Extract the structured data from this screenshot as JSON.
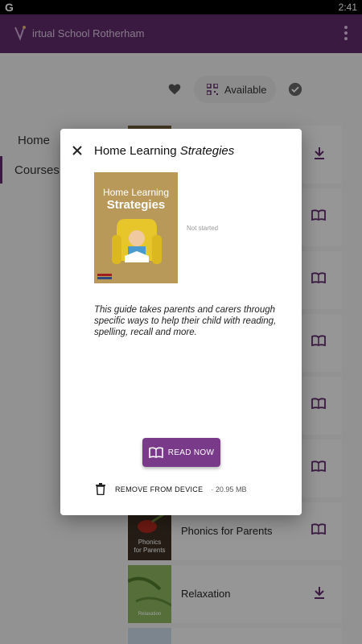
{
  "status": {
    "time": "2:41",
    "g": "G"
  },
  "app": {
    "title": "irtual School Rotherham"
  },
  "toolbar": {
    "available_label": "Available"
  },
  "nav": {
    "home": "Home",
    "courses": "Courses"
  },
  "courses": [
    {
      "title": "",
      "action": "download"
    },
    {
      "title": "",
      "action": "read"
    },
    {
      "title": "",
      "action": "read"
    },
    {
      "title": "",
      "action": "read"
    },
    {
      "title": "",
      "action": "read"
    },
    {
      "title": "",
      "action": "read"
    },
    {
      "title": "Phonics for Parents",
      "action": "read",
      "thumb_text_1": "Phonics",
      "thumb_text_2": "for Parents"
    },
    {
      "title": "Relaxation",
      "action": "download",
      "thumb_text_1": "Relaxation"
    }
  ],
  "dialog": {
    "title_main": "Home Learning ",
    "title_italic": "Strategies",
    "cover_line1": "Home Learning",
    "cover_line2": "Strategies",
    "status": "Not started",
    "description": "This guide takes parents and carers through specific ways to help their child with reading, spelling, recall and more.",
    "read_now": "READ NOW",
    "remove": "REMOVE FROM DEVICE",
    "size": "· 20.95 MB"
  },
  "colors": {
    "primary": "#5e2a6a",
    "accent": "#7a3a8a",
    "icon": "#5e2a6a"
  }
}
